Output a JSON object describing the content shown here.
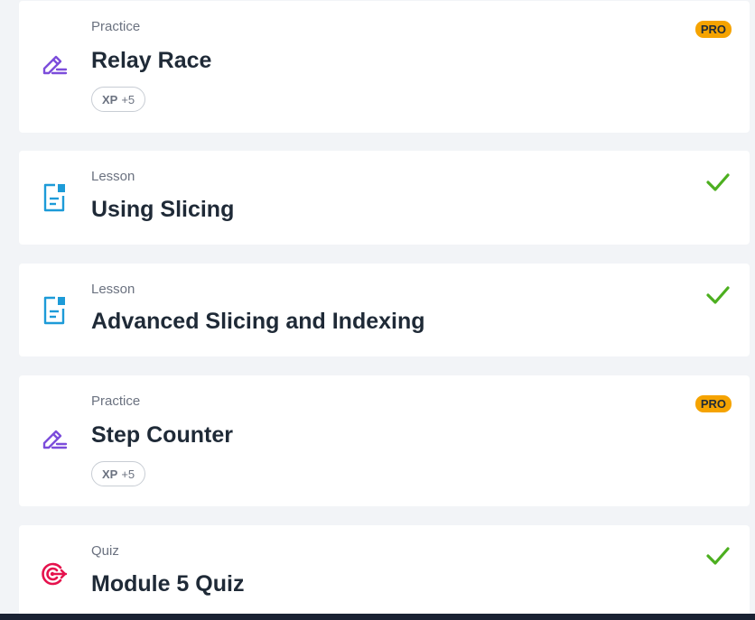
{
  "items": [
    {
      "type": "Practice",
      "title": "Relay Race",
      "icon": "pencil-icon",
      "badge": "PRO",
      "xp_label": "XP",
      "xp_value": "+5",
      "completed": false
    },
    {
      "type": "Lesson",
      "title": "Using Slicing",
      "icon": "document-icon",
      "completed": true
    },
    {
      "type": "Lesson",
      "title": "Advanced Slicing and Indexing",
      "icon": "document-icon",
      "completed": true
    },
    {
      "type": "Practice",
      "title": "Step Counter",
      "icon": "pencil-icon",
      "badge": "PRO",
      "xp_label": "XP",
      "xp_value": "+5",
      "completed": false
    },
    {
      "type": "Quiz",
      "title": "Module 5 Quiz",
      "icon": "target-icon",
      "completed": true
    }
  ],
  "colors": {
    "practice_icon": "#7c4ddb",
    "lesson_icon": "#1d9bd8",
    "quiz_icon": "#e5124d",
    "check": "#4caf1f",
    "pro_badge": "#f5a300"
  }
}
